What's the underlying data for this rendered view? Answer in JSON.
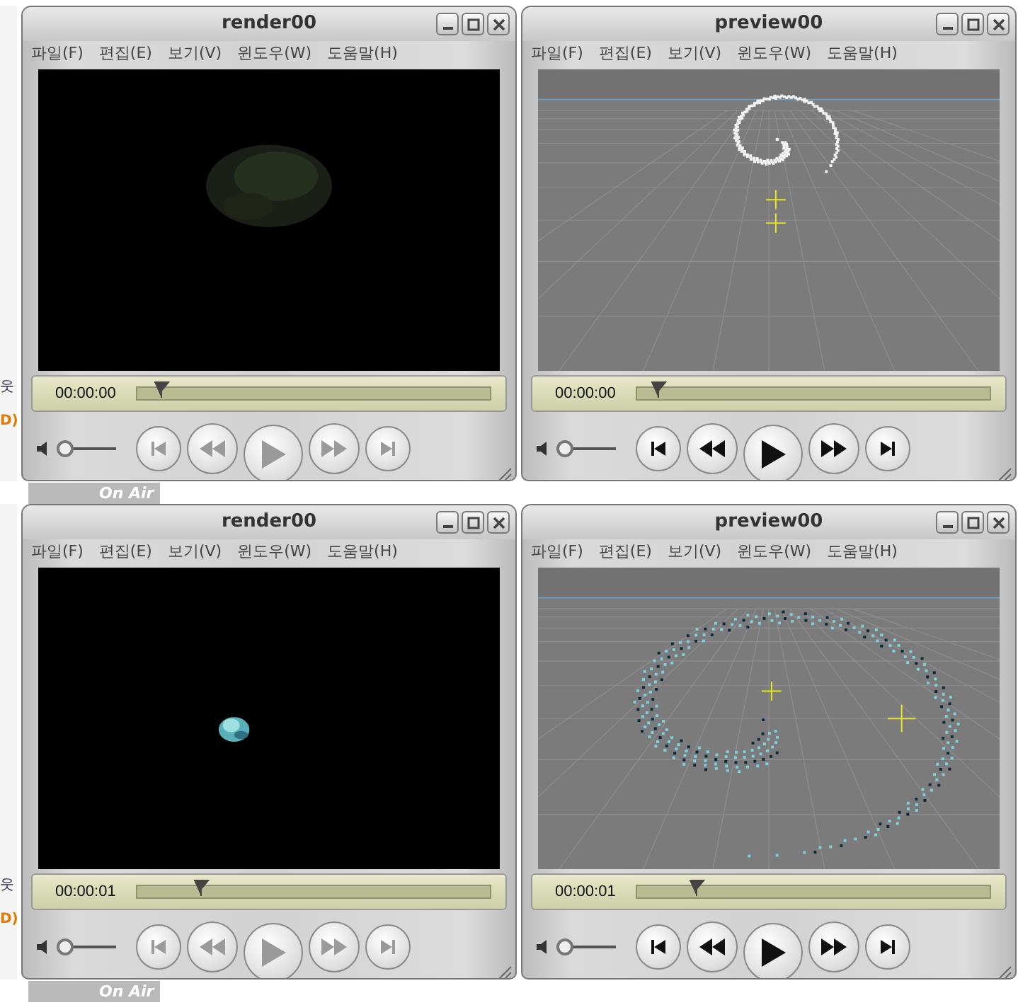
{
  "background": {
    "banners": [
      "On Air",
      "On Air"
    ],
    "edge_texts": [
      [
        "웃",
        "D)"
      ],
      [
        "웃",
        "D)"
      ]
    ]
  },
  "windows": [
    {
      "title": "render00",
      "kind": "render",
      "menu": [
        "파일(F)",
        "편집(E)",
        "보기(V)",
        "윈도우(W)",
        "도움말(H)"
      ],
      "time": "00:00:00",
      "position": {
        "level": 0.07
      },
      "volume": {
        "level": 0
      },
      "controls_disabled": true
    },
    {
      "title": "preview00",
      "kind": "preview",
      "menu": [
        "파일(F)",
        "편집(E)",
        "보기(V)",
        "윈도우(W)",
        "도움말(H)"
      ],
      "time": "00:00:00",
      "position": {
        "level": 0.06
      },
      "volume": {
        "level": 0
      },
      "controls_disabled": false
    },
    {
      "title": "render00",
      "kind": "render",
      "menu": [
        "파일(F)",
        "편집(E)",
        "보기(V)",
        "윈도우(W)",
        "도움말(H)"
      ],
      "time": "00:00:01",
      "position": {
        "level": 0.18
      },
      "volume": {
        "level": 0
      },
      "controls_disabled": true
    },
    {
      "title": "preview00",
      "kind": "preview",
      "menu": [
        "파일(F)",
        "편집(E)",
        "보기(V)",
        "윈도우(W)",
        "도움말(H)"
      ],
      "time": "00:00:01",
      "position": {
        "level": 0.17
      },
      "volume": {
        "level": 0
      },
      "controls_disabled": false
    }
  ]
}
